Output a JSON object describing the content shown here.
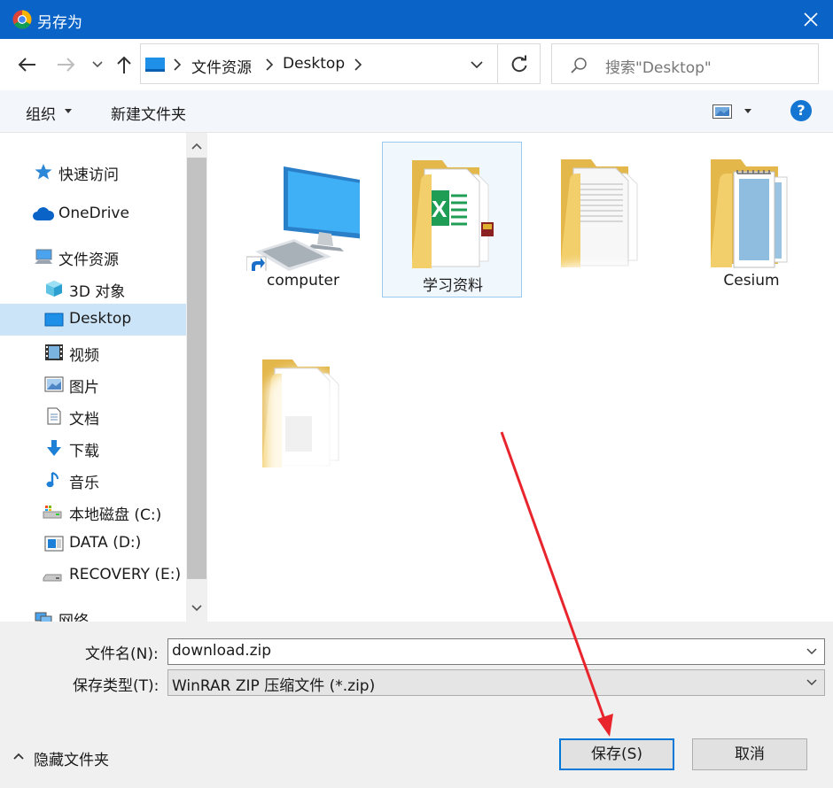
{
  "window": {
    "title": "另存为"
  },
  "address": {
    "crumbs": [
      "文件资源",
      "Desktop"
    ]
  },
  "search": {
    "placeholder": "搜索\"Desktop\""
  },
  "toolbar": {
    "organize": "组织",
    "new_folder": "新建文件夹"
  },
  "sidebar": {
    "items": [
      {
        "label": "快速访问",
        "icon": "star-icon"
      },
      {
        "label": "OneDrive",
        "icon": "cloud-icon"
      },
      {
        "label": "文件资源",
        "icon": "computer-icon"
      },
      {
        "label": "3D 对象",
        "icon": "cube-icon"
      },
      {
        "label": "Desktop",
        "icon": "desktop-icon",
        "selected": true
      },
      {
        "label": "视频",
        "icon": "video-icon"
      },
      {
        "label": "图片",
        "icon": "picture-icon"
      },
      {
        "label": "文档",
        "icon": "document-icon"
      },
      {
        "label": "下载",
        "icon": "download-arrow-icon"
      },
      {
        "label": "音乐",
        "icon": "music-note-icon"
      },
      {
        "label": "本地磁盘 (C:)",
        "icon": "drive-c-icon"
      },
      {
        "label": "DATA (D:)",
        "icon": "drive-d-icon"
      },
      {
        "label": "RECOVERY (E:)",
        "icon": "drive-e-icon"
      },
      {
        "label": "网络",
        "icon": "network-icon"
      }
    ]
  },
  "files": [
    {
      "label": "computer",
      "icon": "computer-shortcut-icon"
    },
    {
      "label": "学习资料",
      "icon": "folder-icon",
      "selected": true
    },
    {
      "label": "",
      "icon": "folder-icon"
    },
    {
      "label": "Cesium",
      "icon": "folder-icon"
    },
    {
      "label": "",
      "icon": "folder-icon"
    }
  ],
  "form": {
    "filename_label": "文件名(N):",
    "filename_value": "download.zip",
    "filetype_label": "保存类型(T):",
    "filetype_value": "WinRAR ZIP 压缩文件 (*.zip)"
  },
  "footer": {
    "hide_folders": "隐藏文件夹",
    "save": "保存(S)",
    "cancel": "取消"
  },
  "colors": {
    "titlebar": "#0a64c8",
    "selection": "#cce4f7",
    "accent": "#0078d7",
    "annotation": "#e8242c"
  }
}
